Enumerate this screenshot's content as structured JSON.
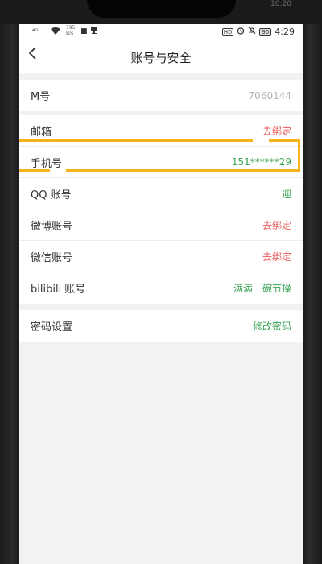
{
  "status_bar": {
    "signal": "⁴ᴳ",
    "speed": "795\nB/s",
    "hd": "HD",
    "battery": "90",
    "time": "4:29",
    "top_time": "10:20"
  },
  "nav": {
    "back_icon": "chevron-left-icon",
    "title": "账号与安全"
  },
  "account": {
    "label": "M号",
    "value": "7060144"
  },
  "bindings": [
    {
      "label": "邮箱",
      "value": "去绑定",
      "color": "#e85b5b"
    },
    {
      "label": "手机号",
      "value": "151******29",
      "color": "#3aa356"
    },
    {
      "label": "QQ 账号",
      "value": "迎",
      "color": "#3aa356"
    },
    {
      "label": "微博账号",
      "value": "去绑定",
      "color": "#e85b5b"
    },
    {
      "label": "微信账号",
      "value": "去绑定",
      "color": "#e85b5b"
    },
    {
      "label": "bilibili 账号",
      "value": "满满一碗节操",
      "color": "#3aa356"
    }
  ],
  "password": {
    "label": "密码设置",
    "value": "修改密码"
  },
  "highlight_color": "#f5b21a"
}
